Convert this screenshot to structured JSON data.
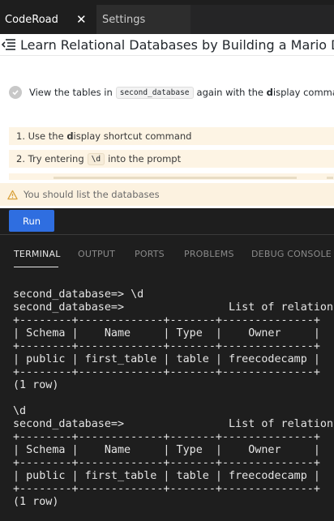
{
  "tabs": [
    {
      "label": "CodeRoad",
      "active": true,
      "close_icon": "close-icon"
    },
    {
      "label": "Settings",
      "active": false
    }
  ],
  "tutorial": {
    "menu_icon": "menu-collapse-icon",
    "title": "Learn Relational Databases by Building a Mario Database"
  },
  "step": {
    "status_icon": "check-circle-icon",
    "text_before": "View the tables in",
    "code": "second_database",
    "text_mid": "again with the",
    "bold_letter": "d",
    "text_after": "isplay command."
  },
  "hints": [
    {
      "number": "1.",
      "text_before": "Use the",
      "bold_letter": "d",
      "text_after": "isplay shortcut command"
    },
    {
      "number": "2.",
      "text_before": "Try entering",
      "code": "\\d",
      "text_after": "into the prompt"
    }
  ],
  "warning": {
    "icon": "warning-icon",
    "text": "You should list the databases"
  },
  "run_button": {
    "label": "Run"
  },
  "panel_tabs": [
    {
      "label": "TERMINAL",
      "active": true
    },
    {
      "label": "OUTPUT",
      "active": false
    },
    {
      "label": "PORTS",
      "active": false
    },
    {
      "label": "PROBLEMS",
      "active": false
    },
    {
      "label": "DEBUG CONSOLE",
      "active": false
    }
  ],
  "terminal": {
    "lines": [
      "second_database=> \\d",
      "second_database=>                List of relations",
      "+--------+-------------+-------+--------------+",
      "| Schema |    Name     | Type  |    Owner     |",
      "+--------+-------------+-------+--------------+",
      "| public | first_table | table | freecodecamp |",
      "+--------+-------------+-------+--------------+",
      "(1 row)",
      "",
      "\\d",
      "second_database=>                List of relations",
      "+--------+-------------+-------+--------------+",
      "| Schema |    Name     | Type  |    Owner     |",
      "+--------+-------------+-------+--------------+",
      "| public | first_table | table | freecodecamp |",
      "+--------+-------------+-------+--------------+",
      "(1 row)"
    ]
  },
  "colors": {
    "editor_bg": "#1e1e1e",
    "tabbar_bg": "#252526",
    "inactive_tab_bg": "#2d2d2d",
    "hint_bg": "#fdf4e4",
    "warning_bg": "#fcf2e0",
    "run_button": "#2f6ee0",
    "warning_icon": "#d9a13b"
  }
}
